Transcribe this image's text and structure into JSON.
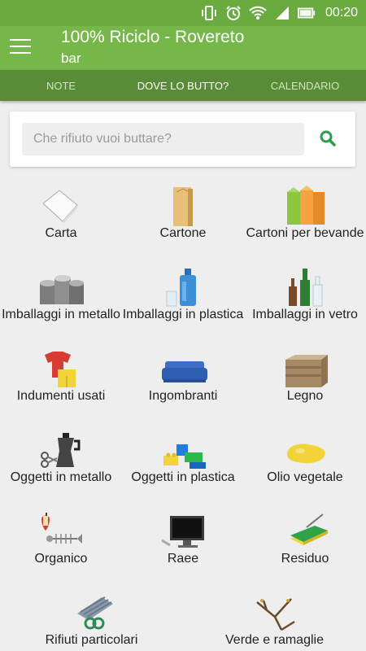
{
  "status_bar": {
    "time": "00:20"
  },
  "app_bar": {
    "title": "100% Riciclo - Rovereto",
    "subtitle": "bar"
  },
  "tabs": [
    {
      "label": "NOTE",
      "active": false
    },
    {
      "label": "DOVE LO BUTTO?",
      "active": true
    },
    {
      "label": "CALENDARIO",
      "active": false
    }
  ],
  "search": {
    "placeholder": "Che rifiuto vuoi buttare?",
    "value": ""
  },
  "colors": {
    "status_bar": "#6aab3f",
    "app_bar": "#76b74a",
    "tab_bar": "#5a8c37",
    "search_icon": "#2e9c4f"
  },
  "categories": [
    {
      "label": "Carta",
      "icon": "paper-icon"
    },
    {
      "label": "Cartone",
      "icon": "cardboard-icon"
    },
    {
      "label": "Cartoni per bevande",
      "icon": "beverage-carton-icon"
    },
    {
      "label": "Imballaggi in metallo",
      "icon": "metal-cans-icon"
    },
    {
      "label": "Imballaggi in plastica",
      "icon": "plastic-bottle-icon"
    },
    {
      "label": "Imballaggi in vetro",
      "icon": "glass-bottles-icon"
    },
    {
      "label": "Indumenti usati",
      "icon": "clothes-icon"
    },
    {
      "label": "Ingombranti",
      "icon": "sofa-icon"
    },
    {
      "label": "Legno",
      "icon": "wooden-crate-icon"
    },
    {
      "label": "Oggetti in metallo",
      "icon": "moka-scissors-icon"
    },
    {
      "label": "Oggetti in plastica",
      "icon": "plastic-bricks-icon"
    },
    {
      "label": "Olio vegetale",
      "icon": "oil-puddle-icon"
    },
    {
      "label": "Organico",
      "icon": "apple-fishbone-icon"
    },
    {
      "label": "Raee",
      "icon": "monitor-icon"
    },
    {
      "label": "Residuo",
      "icon": "sponge-icon"
    },
    {
      "label": "Rifiuti particolari",
      "icon": "special-waste-icon"
    },
    {
      "label": "Verde e ramaglie",
      "icon": "branches-icon"
    }
  ]
}
